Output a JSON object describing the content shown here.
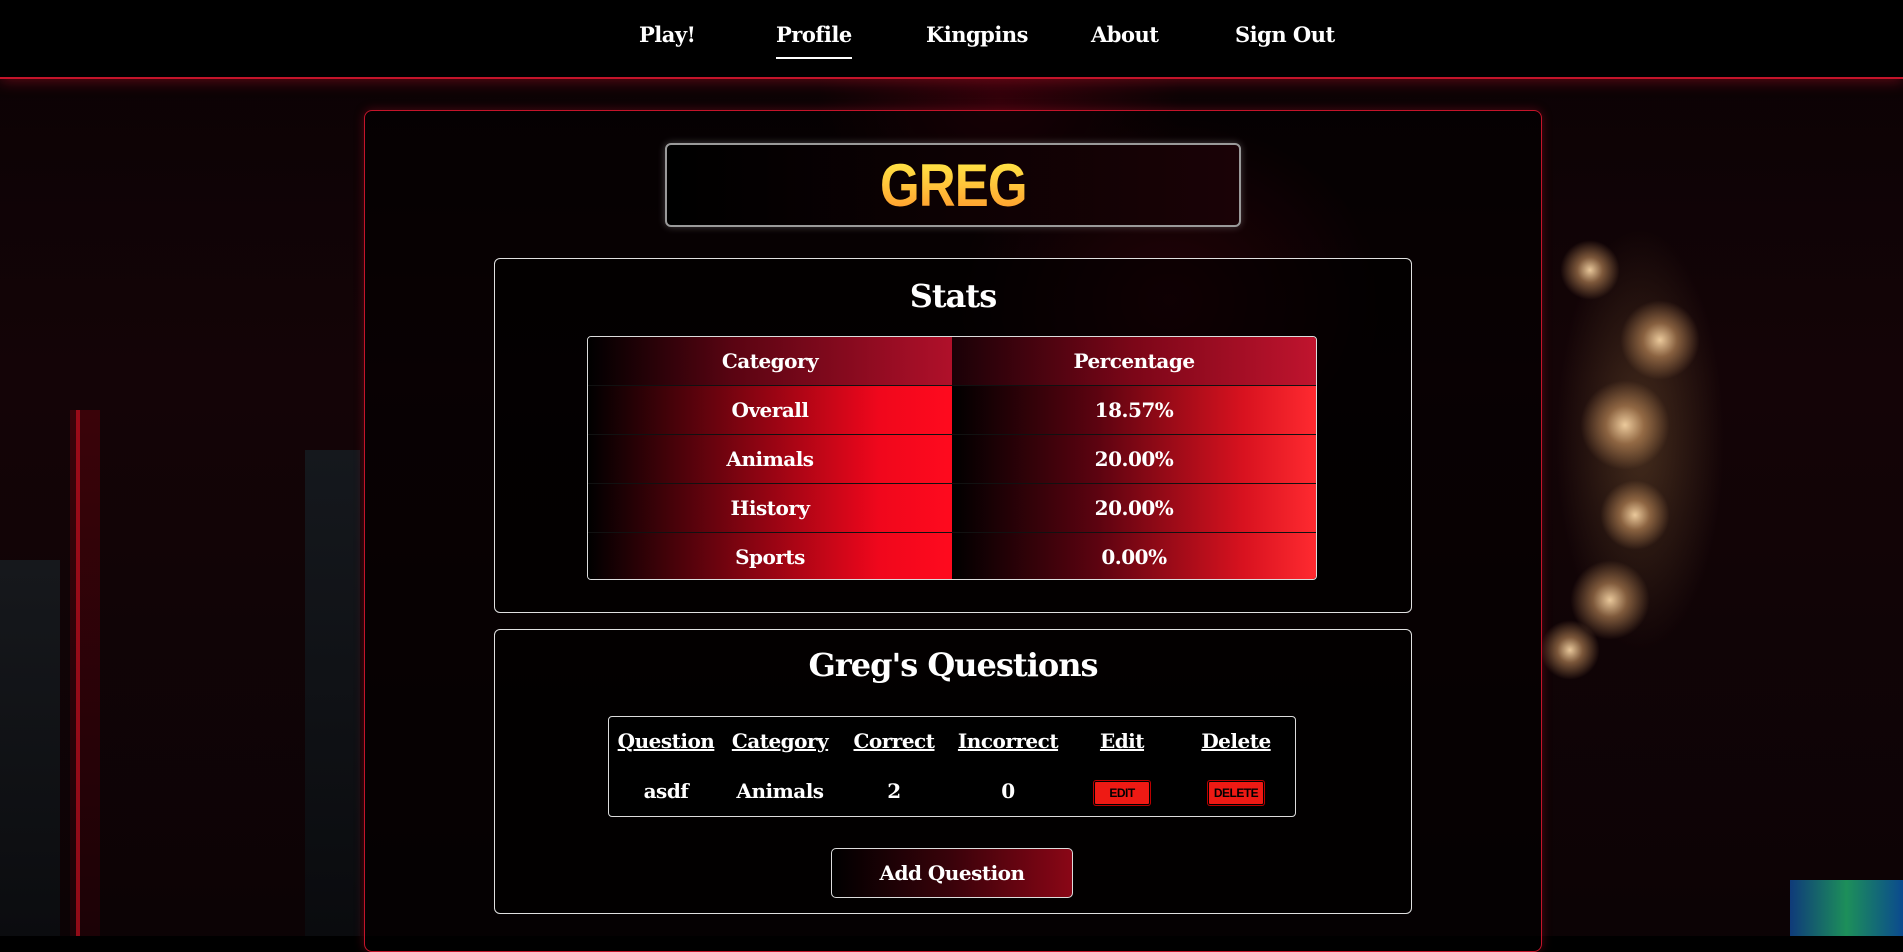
{
  "nav": {
    "items": [
      {
        "label": "Play!"
      },
      {
        "label": "Profile",
        "active": true
      },
      {
        "label": "Kingpins"
      },
      {
        "label": "About"
      },
      {
        "label": "Sign Out"
      }
    ]
  },
  "profile": {
    "username": "GREG"
  },
  "stats": {
    "title": "Stats",
    "headers": [
      "Category",
      "Percentage"
    ],
    "rows": [
      {
        "category": "Overall",
        "percentage": "18.57%"
      },
      {
        "category": "Animals",
        "percentage": "20.00%"
      },
      {
        "category": "History",
        "percentage": "20.00%"
      },
      {
        "category": "Sports",
        "percentage": "0.00%"
      }
    ]
  },
  "questions": {
    "title": "Greg's Questions",
    "headers": [
      "Question",
      "Category",
      "Correct",
      "Incorrect",
      "Edit",
      "Delete"
    ],
    "rows": [
      {
        "question": "asdf",
        "category": "Animals",
        "correct": "2",
        "incorrect": "0",
        "edit_label": "EDIT",
        "delete_label": "DELETE"
      }
    ],
    "add_button_label": "Add Question"
  },
  "colors": {
    "accent": "#c4142a",
    "button_red": "#ee1a14",
    "name_gradient_top": "#fff24a",
    "name_gradient_bottom": "#ff8f2a"
  }
}
